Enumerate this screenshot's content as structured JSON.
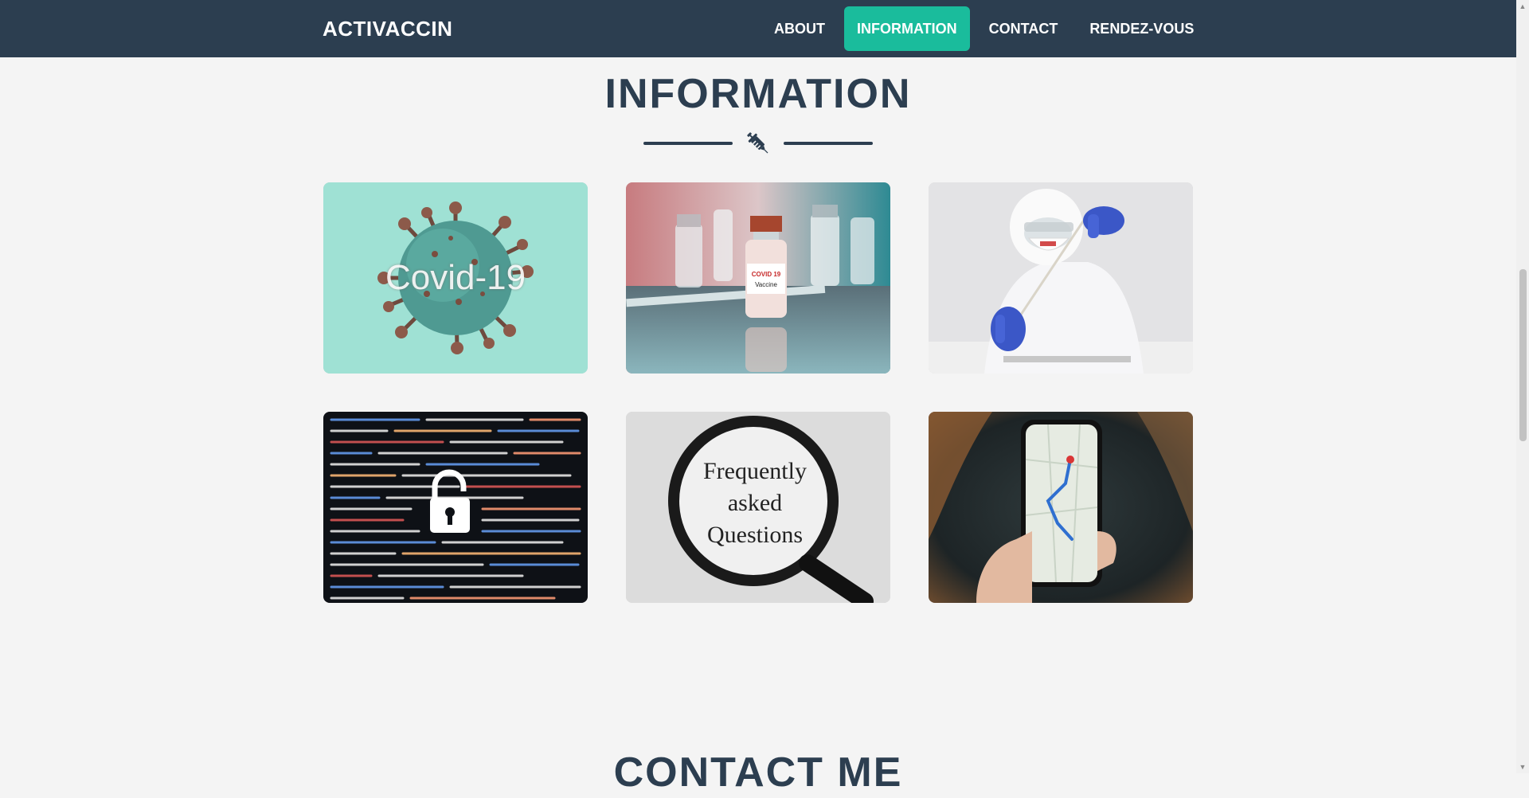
{
  "navbar": {
    "brand": "ACTIVACCIN",
    "links": [
      {
        "label": "ABOUT",
        "active": false
      },
      {
        "label": "INFORMATION",
        "active": true
      },
      {
        "label": "CONTACT",
        "active": false
      },
      {
        "label": "RENDEZ-VOUS",
        "active": false
      }
    ]
  },
  "information": {
    "title": "INFORMATION",
    "divider_icon": "syringe-icon",
    "cards": [
      {
        "image": "covid-virus-image",
        "overlay_text": "Covid-19"
      },
      {
        "image": "vaccine-vials-image"
      },
      {
        "image": "lab-worker-swab-test-image"
      },
      {
        "image": "code-padlock-security-image"
      },
      {
        "image": "faq-magnifying-glass-image",
        "overlay_lines": [
          "Frequently",
          "asked",
          "Questions"
        ]
      },
      {
        "image": "phone-map-navigation-image"
      }
    ]
  },
  "next_section": {
    "title": "CONTACT ME"
  },
  "colors": {
    "navbar": "#2c3e50",
    "accent": "#1abc9c",
    "heading": "#2c3e50",
    "background": "#f4f4f4"
  }
}
